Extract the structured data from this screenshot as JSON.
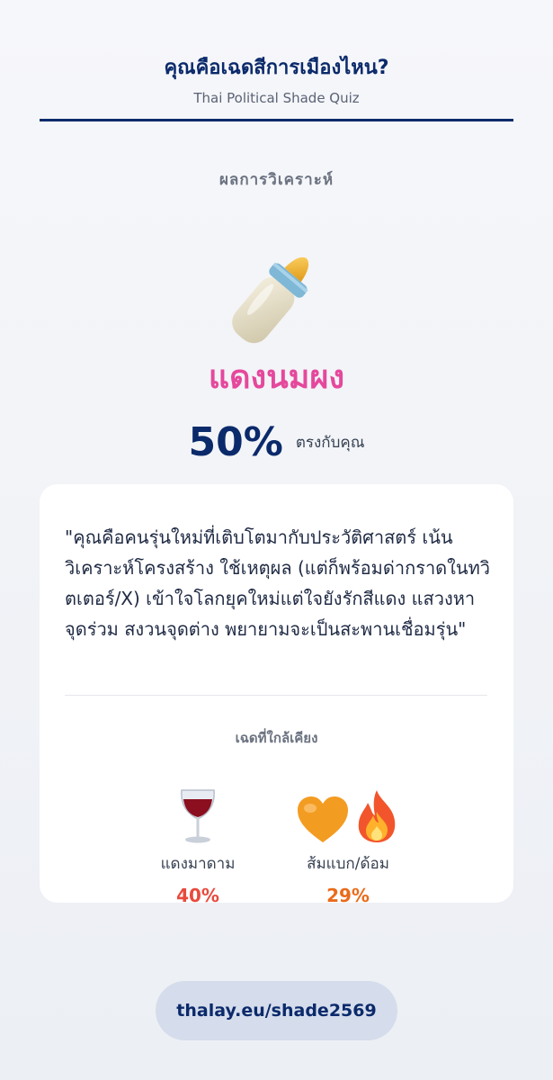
{
  "header": {
    "title": "คุณคือเฉดสีการเมืองไหน?",
    "subtitle": "Thai Political Shade Quiz"
  },
  "result": {
    "section_label": "ผลการวิเคราะห์",
    "icon": "baby-bottle-icon",
    "shade_name": "แดงนมผง",
    "shade_color": "#e5489c",
    "match_percent": "50%",
    "match_label": "ตรงกับคุณ",
    "quote": "\"คุณคือคนรุ่นใหม่ที่เติบโตมากับประวัติศาสตร์ เน้นวิเคราะห์โครงสร้าง ใช้เหตุผล (แต่ก็พร้อมด่ากราดในทวิตเตอร์/X) เข้าใจโลกยุคใหม่แต่ใจยังรักสีแดง แสวงหาจุดร่วม สงวนจุดต่าง พยายามจะเป็นสะพานเชื่อมรุ่น\""
  },
  "nearby": {
    "label": "เฉดที่ใกล้เคียง",
    "items": [
      {
        "icons": [
          "wine-glass-icon"
        ],
        "name": "แดงมาดาม",
        "percent": "40%",
        "color": "#e84a3c"
      },
      {
        "icons": [
          "orange-heart-icon",
          "fire-icon"
        ],
        "name": "ส้มแบก/ด้อม",
        "percent": "29%",
        "color": "#ea6b1a"
      }
    ]
  },
  "footer": {
    "url": "thalay.eu/shade2569"
  },
  "colors": {
    "brand_navy": "#0b2a6b",
    "background": "#eef1f6"
  }
}
